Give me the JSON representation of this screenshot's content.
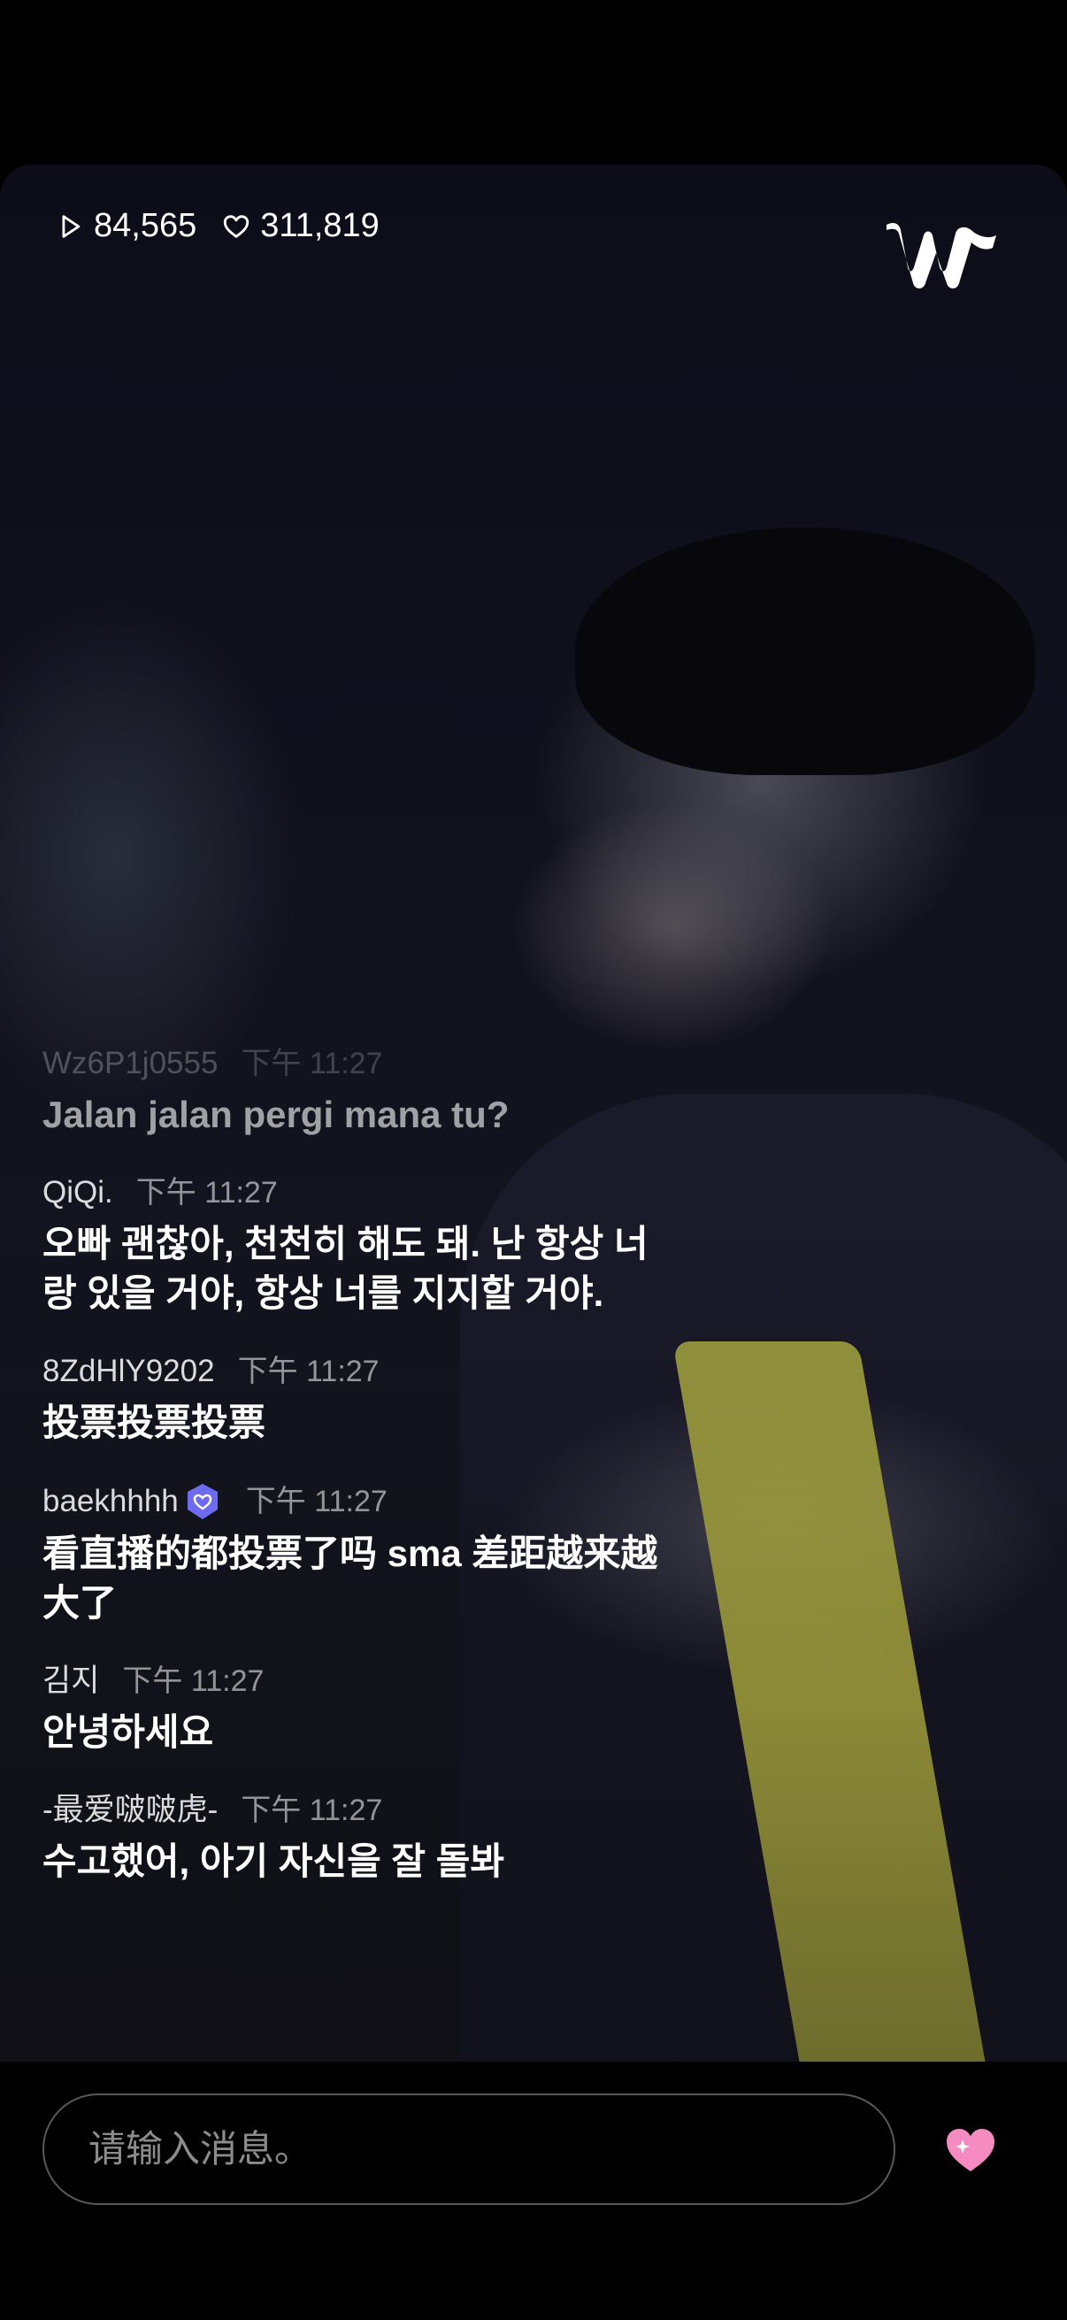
{
  "stats": {
    "views": "84,565",
    "likes": "311,819"
  },
  "chat": {
    "messages": [
      {
        "user": "Wz6P1j0555",
        "time": "下午 11:27",
        "text": "Jalan jalan pergi mana tu?"
      },
      {
        "user": "QiQi.",
        "time": "下午 11:27",
        "text": "오빠 괜찮아, 천천히 해도 돼. 난 항상 너랑 있을 거야, 항상 너를 지지할 거야."
      },
      {
        "user": "8ZdHlY9202",
        "time": "下午 11:27",
        "text": "投票投票投票"
      },
      {
        "user": "baekhhhh",
        "time": "下午 11:27",
        "text": "看直播的都投票了吗 sma 差距越来越大了"
      },
      {
        "user": "김지",
        "time": "下午 11:27",
        "text": "안녕하세요"
      },
      {
        "user": "-最爱啵啵虎-",
        "time": "下午 11:27",
        "text": "수고했어, 아기 자신을 잘 돌봐"
      }
    ]
  },
  "input": {
    "placeholder": "请输入消息。"
  },
  "colors": {
    "background": "#000000",
    "heart": "#f58bc0",
    "badge": "#6d6cf0"
  },
  "icons": {
    "views": "play-icon",
    "likes": "heart-outline-icon",
    "brand": "weverse-logo",
    "send_heart": "heart-sparkle-icon"
  }
}
